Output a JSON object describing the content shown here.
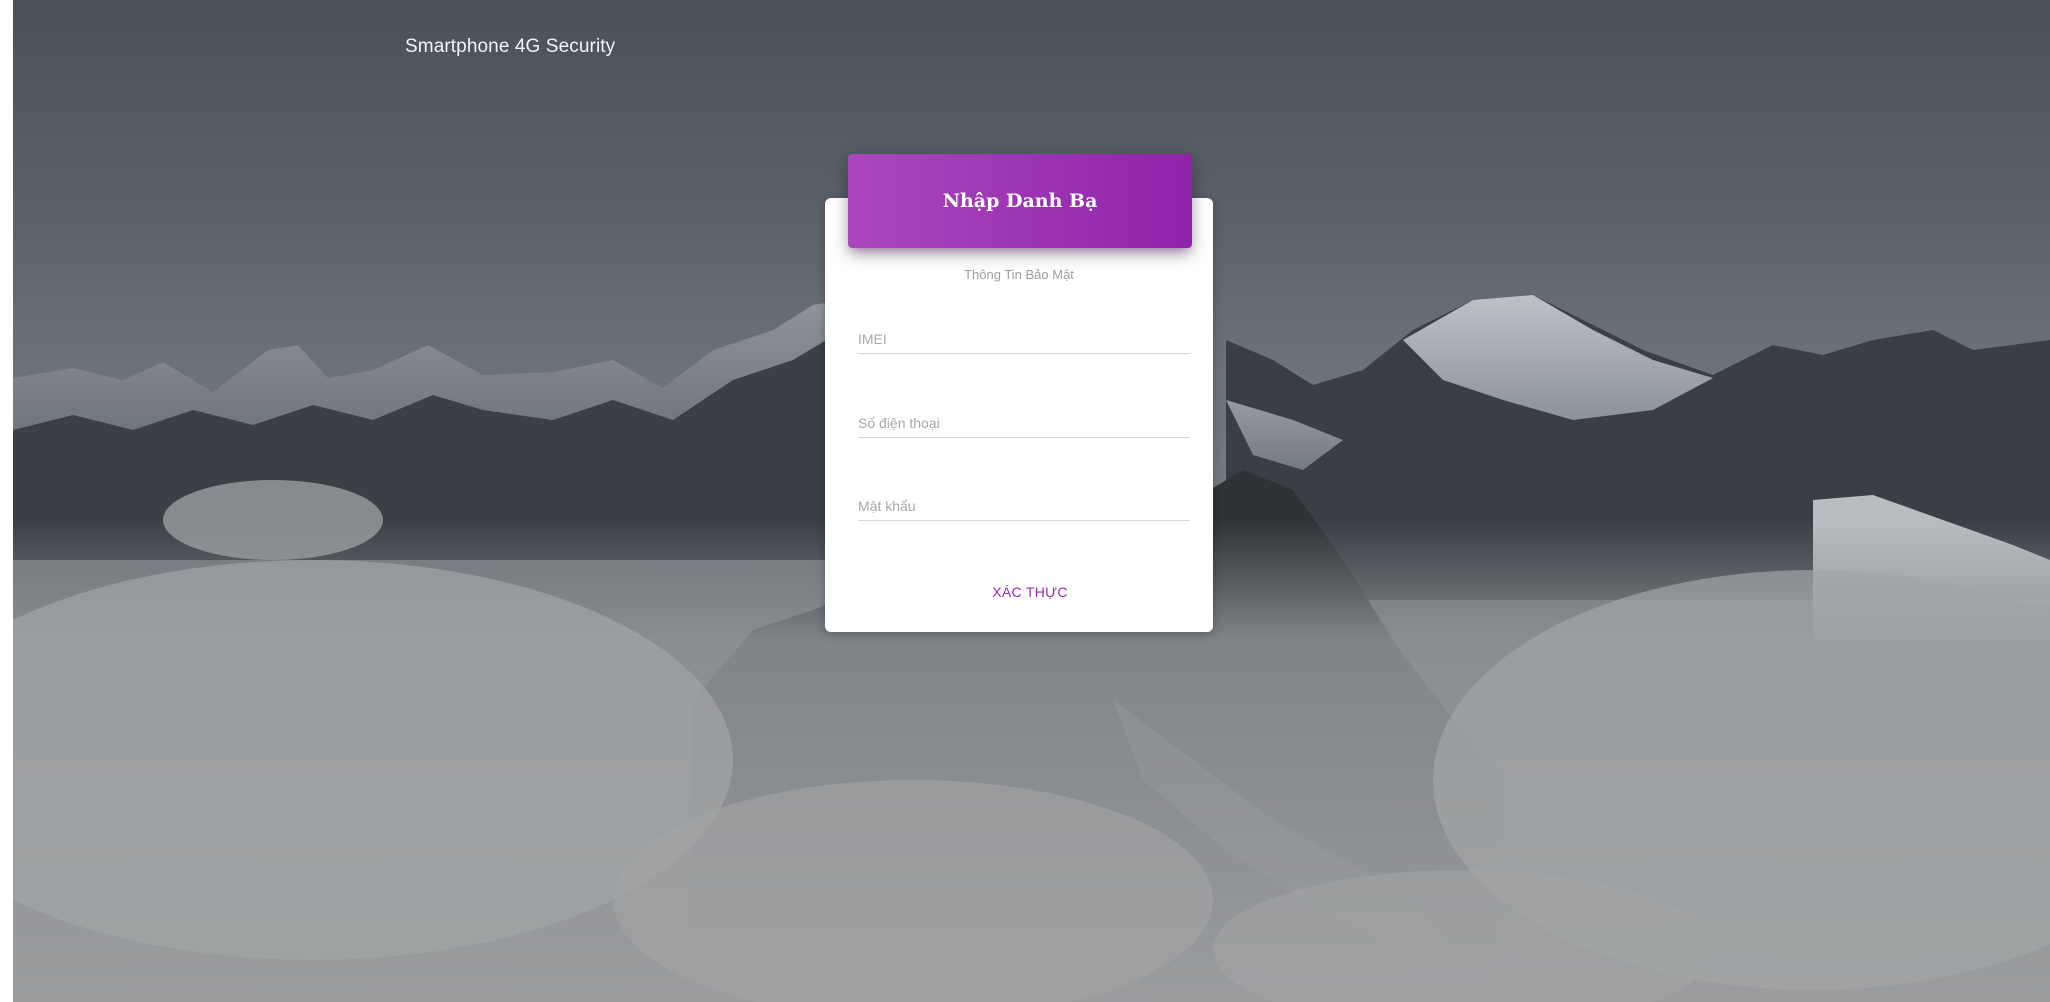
{
  "brand": {
    "title": "Smartphone 4G Security"
  },
  "card": {
    "title": "Nhập Danh Bạ",
    "subtitle": "Thông Tin Bảo Mật",
    "fields": {
      "imei": {
        "placeholder": "IMEI",
        "value": ""
      },
      "phone": {
        "placeholder": "Số điện thoại",
        "value": ""
      },
      "password": {
        "placeholder": "Mật khẩu",
        "value": ""
      }
    },
    "submit_label": "XÁC THỰC"
  },
  "colors": {
    "accent": "#9c27b0",
    "header_gradient_start": "#ab47bc",
    "header_gradient_end": "#8e24aa"
  }
}
